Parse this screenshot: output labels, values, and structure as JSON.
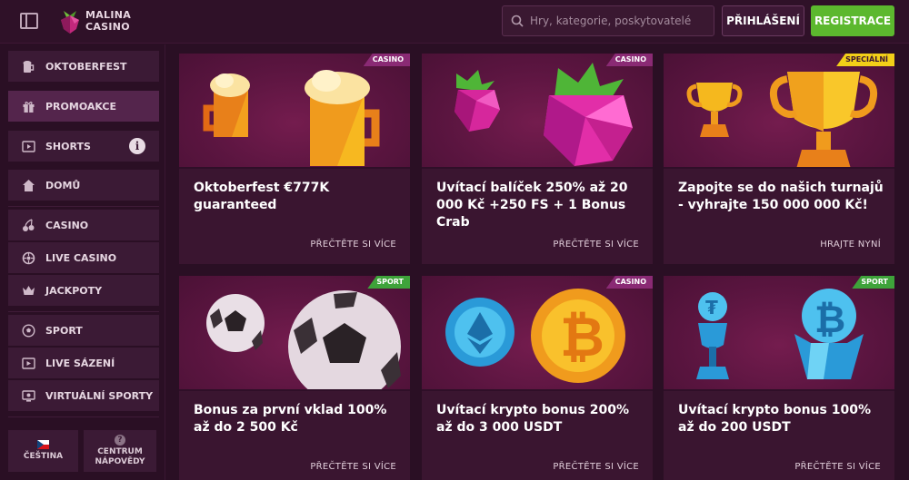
{
  "header": {
    "logo_line1": "MALINA",
    "logo_line2": "CASINO",
    "search_placeholder": "Hry, kategorie, poskytovatelé",
    "login_label": "PŘIHLÁŠENÍ",
    "register_label": "REGISTRACE"
  },
  "sidebar": {
    "items": [
      {
        "label": "OKTOBERFEST",
        "icon": "beer-icon"
      },
      {
        "label": "PROMOAKCE",
        "icon": "gift-icon"
      },
      {
        "label": "SHORTS",
        "icon": "video-icon"
      },
      {
        "label": "DOMŮ",
        "icon": "home-icon"
      },
      {
        "label": "CASINO",
        "icon": "cherries-icon"
      },
      {
        "label": "LIVE CASINO",
        "icon": "roulette-icon"
      },
      {
        "label": "JACKPOTY",
        "icon": "crown-icon"
      },
      {
        "label": "SPORT",
        "icon": "soccer-ball-icon"
      },
      {
        "label": "LIVE SÁZENÍ",
        "icon": "live-icon"
      },
      {
        "label": "VIRTUÁLNÍ SPORTY",
        "icon": "monitor-icon"
      }
    ],
    "info_glyph": "i",
    "footer": {
      "language_label": "ČEŠTINA",
      "help_label_line1": "CENTRUM",
      "help_label_line2": "NÁPOVĚDY",
      "help_glyph": "?"
    }
  },
  "cards": [
    {
      "badge": "CASINO",
      "badge_type": "casino",
      "title": "Oktoberfest €777K guaranteed",
      "link": "PŘEČTĚTE SI VÍCE",
      "art": "beer-mugs"
    },
    {
      "badge": "CASINO",
      "badge_type": "casino",
      "title": "Uvítací balíček 250% až 20 000 Kč +250 FS + 1 Bonus Crab",
      "link": "PŘEČTĚTE SI VÍCE",
      "art": "raspberries"
    },
    {
      "badge": "SPECIÁLNÍ",
      "badge_type": "special",
      "title": "Zapojte se do našich turnajů - vyhrajte 150 000 000 Kč!",
      "link": "HRAJTE NYNÍ",
      "art": "trophies"
    },
    {
      "badge": "SPORT",
      "badge_type": "sport",
      "title": "Bonus za první vklad 100% až do 2 500 Kč",
      "link": "PŘEČTĚTE SI VÍCE",
      "art": "soccer-balls"
    },
    {
      "badge": "CASINO",
      "badge_type": "casino",
      "title": "Uvítací krypto bonus 200% až do 3 000 USDT",
      "link": "PŘEČTĚTE SI VÍCE",
      "art": "crypto-coins"
    },
    {
      "badge": "SPORT",
      "badge_type": "sport",
      "title": "Uvítací krypto bonus 100% až do 200 USDT",
      "link": "PŘEČTĚTE SI VÍCE",
      "art": "crypto-trophies"
    }
  ],
  "colors": {
    "background": "#2a0f24",
    "card": "#3a1530",
    "register_green": "#5cb82e",
    "sport_badge": "#3ea33a",
    "special_badge": "#f2cf18",
    "casino_badge": "#8a2a74"
  }
}
